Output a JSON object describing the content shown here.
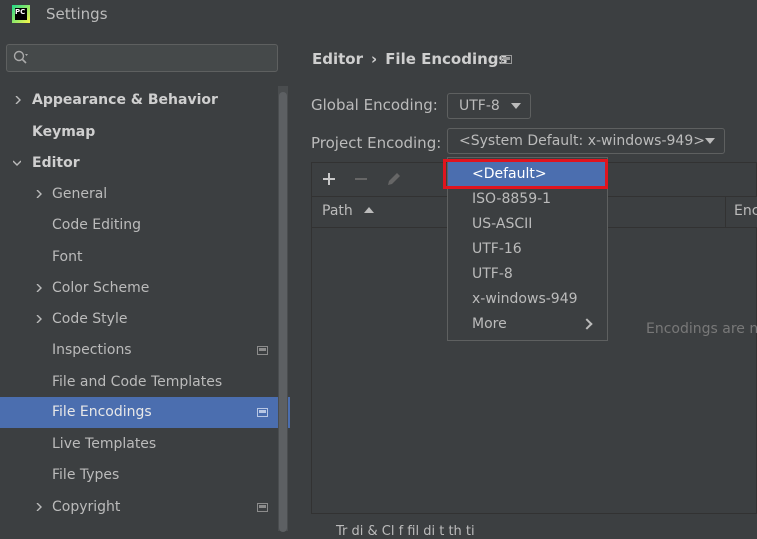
{
  "window": {
    "title": "Settings",
    "app_icon_text": "PC"
  },
  "search": {
    "value": "",
    "placeholder": ""
  },
  "sidebar": {
    "items": [
      {
        "label": "Appearance & Behavior",
        "expanded": false
      },
      {
        "label": "Keymap"
      },
      {
        "label": "Editor",
        "expanded": true
      },
      {
        "label": "General"
      },
      {
        "label": "Code Editing"
      },
      {
        "label": "Font"
      },
      {
        "label": "Color Scheme"
      },
      {
        "label": "Code Style"
      },
      {
        "label": "Inspections"
      },
      {
        "label": "File and Code Templates"
      },
      {
        "label": "File Encodings",
        "selected": true
      },
      {
        "label": "Live Templates"
      },
      {
        "label": "File Types"
      },
      {
        "label": "Copyright"
      }
    ]
  },
  "breadcrumb": {
    "parent": "Editor",
    "separator": "›",
    "current": "File Encodings"
  },
  "form": {
    "global_label": "Global Encoding:",
    "global_value": "UTF-8",
    "project_label": "Project Encoding:",
    "project_value": "<System Default: x-windows-949>"
  },
  "table": {
    "columns": [
      "Path",
      "Enc"
    ],
    "empty_text": "Encodings are n"
  },
  "dropdown": {
    "options": [
      "<Default>",
      "ISO-8859-1",
      "US-ASCII",
      "UTF-16",
      "UTF-8",
      "x-windows-949",
      "More"
    ],
    "selected_index": 0
  },
  "footer": {
    "text": "Tr         di  &  Cl        f   fil   di     t   th    ti"
  },
  "colors": {
    "accent": "#4b6eaf",
    "highlight": "#e0141e",
    "background": "#3c3f41"
  }
}
